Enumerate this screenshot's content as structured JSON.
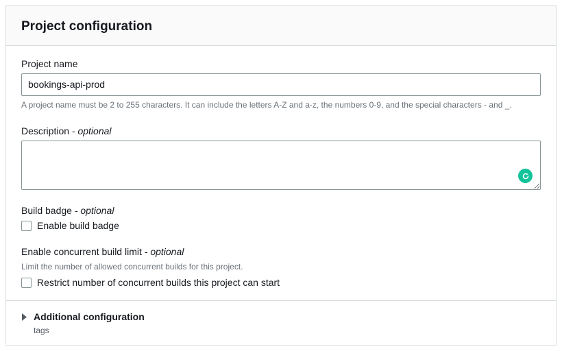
{
  "panel": {
    "title": "Project configuration"
  },
  "projectName": {
    "label": "Project name",
    "value": "bookings-api-prod",
    "help": "A project name must be 2 to 255 characters. It can include the letters A-Z and a-z, the numbers 0-9, and the special characters - and _."
  },
  "description": {
    "label": "Description",
    "optional": "- optional",
    "value": ""
  },
  "buildBadge": {
    "label": "Build badge",
    "optional": "- optional",
    "checkboxLabel": "Enable build badge"
  },
  "concurrent": {
    "label": "Enable concurrent build limit",
    "optional": "- optional",
    "help": "Limit the number of allowed concurrent builds for this project.",
    "checkboxLabel": "Restrict number of concurrent builds this project can start"
  },
  "expander": {
    "title": "Additional configuration",
    "subtitle": "tags"
  }
}
